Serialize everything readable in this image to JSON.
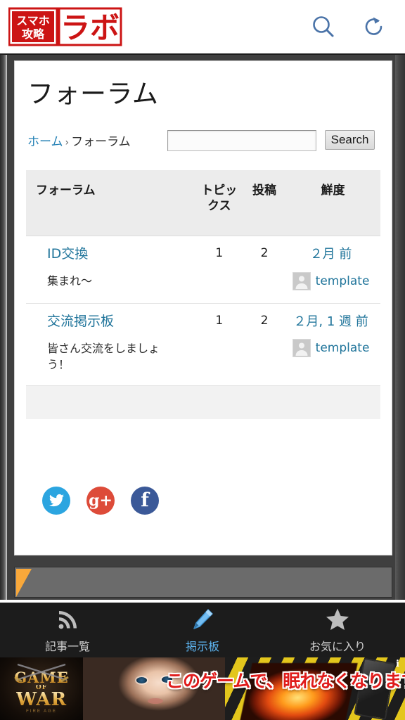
{
  "app_header": {
    "logo_text": "スマホ攻略ラボ",
    "search_icon": "search-icon",
    "refresh_icon": "refresh-icon"
  },
  "page": {
    "title": "フォーラム",
    "breadcrumb": {
      "home_label": "ホーム",
      "separator": "›",
      "current_label": "フォーラム"
    },
    "search": {
      "value": "",
      "placeholder": "",
      "button_label": "Search"
    }
  },
  "table": {
    "headers": {
      "forum": "フォーラム",
      "topics_line1": "トピッ",
      "topics_line2": "クス",
      "posts": "投稿",
      "freshness": "鮮度"
    },
    "rows": [
      {
        "name": "ID交換",
        "description": "集まれ～",
        "topics": "1",
        "posts": "2",
        "freshness": "２月 前",
        "author": "template",
        "avatar_icon": "user-avatar-icon"
      },
      {
        "name": "交流掲示板",
        "description": "皆さん交流をしましょう！",
        "topics": "1",
        "posts": "2",
        "freshness": "２月, 1 週 前",
        "author": "template",
        "avatar_icon": "user-avatar-icon"
      }
    ]
  },
  "social": {
    "twitter": {
      "icon": "twitter-icon",
      "color": "#2ca5e0"
    },
    "googleplus": {
      "icon": "google-plus-icon",
      "label": "g+",
      "color": "#dd4b39"
    },
    "facebook": {
      "icon": "facebook-icon",
      "label": "f",
      "color": "#3b5998"
    }
  },
  "bottom_nav": {
    "items": [
      {
        "label": "記事一覧",
        "icon": "rss-icon",
        "active": false
      },
      {
        "label": "掲示板",
        "icon": "pencil-icon",
        "active": true
      },
      {
        "label": "お気に入り",
        "icon": "star-icon",
        "active": false
      }
    ],
    "active_color": "#5db4f0"
  },
  "ad": {
    "brand_line1": "GAME",
    "brand_of": "OF",
    "brand_line2": "WAR",
    "brand_sub": "FIRE AGE",
    "copy": "このゲームで、眠れなくなります。",
    "info_label": "i",
    "copy_color": "#e01b1b"
  }
}
